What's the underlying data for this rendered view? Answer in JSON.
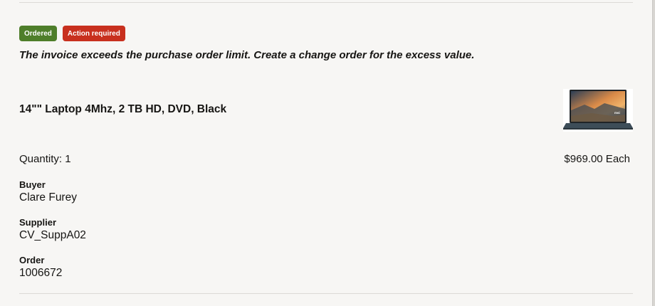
{
  "status": {
    "ordered_label": "Ordered",
    "action_label": "Action required",
    "colors": {
      "ordered": "#4e7e2a",
      "action": "#c8301e"
    }
  },
  "message": "The invoice exceeds the purchase order limit. Create a change order for the excess value.",
  "item": {
    "title": "14\"\" Laptop 4Mhz, 2 TB HD, DVD, Black",
    "image_icon": "laptop-thumbnail",
    "quantity": "Quantity: 1",
    "price": "$969.00 Each"
  },
  "details": {
    "buyer_label": "Buyer",
    "buyer_value": "Clare Furey",
    "supplier_label": "Supplier",
    "supplier_value": "CV_SuppA02",
    "order_label": "Order",
    "order_value": "1006672"
  }
}
